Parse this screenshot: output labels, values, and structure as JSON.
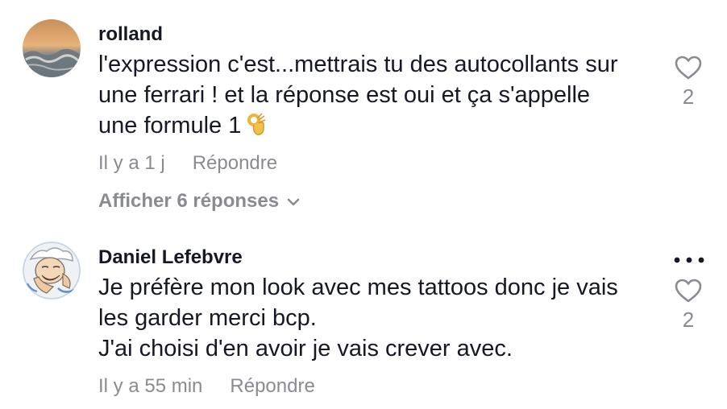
{
  "comments": [
    {
      "author": "rolland",
      "lines": [
        "l'expression c'est...mettrais tu des autocollants sur",
        "une ferrari ! et la réponse est oui et ça s'appelle",
        "une formule 1"
      ],
      "emoji": "ok-hand-emoji",
      "time": "Il y a 1 j",
      "reply_label": "Répondre",
      "like_count": "2",
      "show_replies_label": "Afficher 6 réponses"
    },
    {
      "author": "Daniel Lefebvre",
      "lines": [
        "Je préfère mon look avec mes tattoos donc je vais",
        "les garder merci bcp.",
        "J'ai choisi d'en avoir je vais crever avec."
      ],
      "time": "Il y a 55 min",
      "reply_label": "Répondre",
      "like_count": "2"
    }
  ],
  "icons": {
    "like": "heart-outline-icon",
    "more": "more-horizontal-icon",
    "expand": "chevron-down-icon"
  },
  "colors": {
    "text": "#161823",
    "secondary": "#8a8b91",
    "background": "#ffffff"
  }
}
